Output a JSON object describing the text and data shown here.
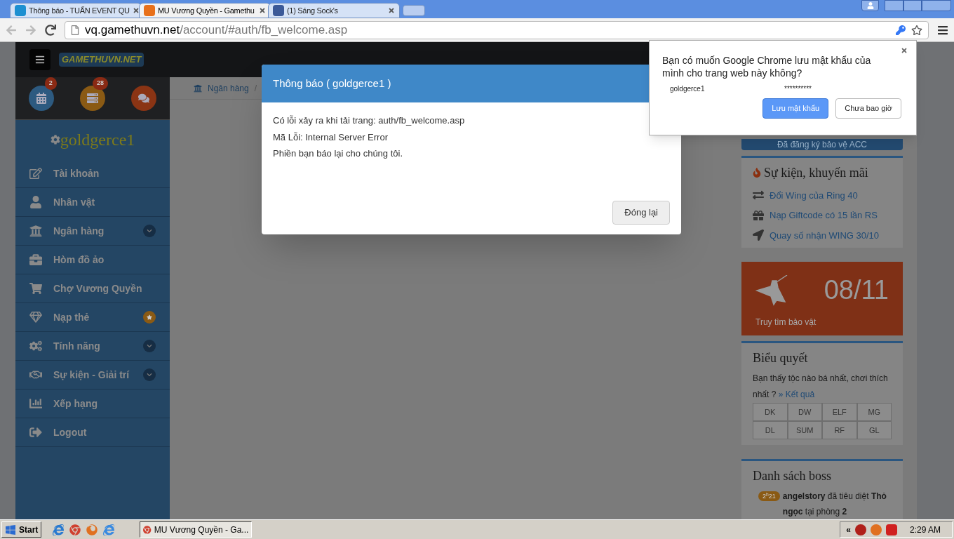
{
  "browser": {
    "tabs": [
      {
        "title": "Thông báo - TUẤN EVENT QU",
        "selected": false
      },
      {
        "title": "MU Vương Quyền - Gamethu",
        "selected": true
      },
      {
        "title": "(1) Sáng Sock's",
        "selected": false
      }
    ],
    "url_host": "vq.gamethuvn.net",
    "url_path": "/account/#auth/fb_welcome.asp"
  },
  "header": {
    "logo": "GAMETHUVN.NET",
    "badges": [
      {
        "count": "2",
        "color": "#2d5a80"
      },
      {
        "count": "28",
        "color": "#8a5a14"
      },
      {
        "color": "#8a3414"
      }
    ]
  },
  "sidebar": {
    "username": "goldgerce1",
    "items": [
      {
        "label": "Tài khoản",
        "kind": "plain"
      },
      {
        "label": "Nhân vật",
        "kind": "plain"
      },
      {
        "label": "Ngân hàng",
        "kind": "expand"
      },
      {
        "label": "Hòm đồ ảo",
        "kind": "plain"
      },
      {
        "label": "Chợ Vương Quyền",
        "kind": "plain"
      },
      {
        "label": "Nạp thẻ",
        "kind": "star"
      },
      {
        "label": "Tính năng",
        "kind": "expand"
      },
      {
        "label": "Sự kiện - Giải trí",
        "kind": "expand"
      },
      {
        "label": "Xếp hạng",
        "kind": "plain"
      },
      {
        "label": "Logout",
        "kind": "plain"
      }
    ]
  },
  "breadcrumb": {
    "label": "Ngân hàng",
    "separator": "/"
  },
  "modal": {
    "title": "Thông báo ( goldgerce1 )",
    "lines": [
      "Có lỗi xảy ra khi tải trang: auth/fb_welcome.asp",
      "Mã Lỗi: Internal Server Error",
      "Phiền bạn báo lại cho chúng tôi."
    ],
    "button": "Đóng lại"
  },
  "password_bubble": {
    "question": "Bạn có muốn Google Chrome lưu mật khẩu của mình cho trang web này không?",
    "username": "goldgerce1",
    "password": "**********",
    "save": "Lưu mật khẩu",
    "never": "Chưa bao giờ"
  },
  "right": {
    "protect": "Đã đăng ký bảo vệ ACC",
    "events": {
      "title": "Sự kiện, khuyến mãi",
      "links": [
        "Đổi Wing của Ring 40",
        "Nạp Giftcode có 15 lần RS",
        "Quay số nhận WING 30/10"
      ]
    },
    "treasure": {
      "date": "08/11",
      "label": "Truy tìm bảo vật"
    },
    "vote": {
      "title": "Biểu quyết",
      "question": "Bạn thấy tộc nào bá nhất, chơi thích nhất ?",
      "result": "» Kết quả",
      "options": [
        "DK",
        "DW",
        "ELF",
        "MG",
        "DL",
        "SUM",
        "RF",
        "GL"
      ]
    },
    "boss": {
      "title": "Danh sách boss",
      "time": "2$^{h}$21",
      "text": "**angelstory** đã tiêu diệt **Thỏ ngọc** tại phòng **2**"
    }
  },
  "taskbar": {
    "start": "Start",
    "task": "MU Vương Quyền - Ga...",
    "collapse": "«",
    "clock": "2:29 AM"
  }
}
